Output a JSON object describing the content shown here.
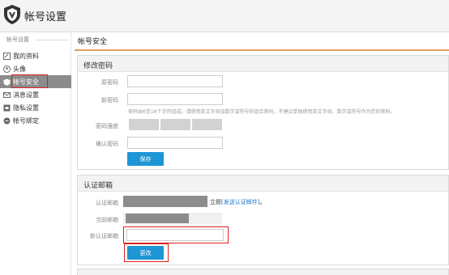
{
  "header": {
    "title": "帐号设置"
  },
  "sidebar": {
    "heading": "帐号设置",
    "items": [
      {
        "label": "我的资料",
        "icon": "edit-icon"
      },
      {
        "label": "头像",
        "icon": "avatar-icon"
      },
      {
        "label": "帐号安全",
        "icon": "shield-icon",
        "active": true
      },
      {
        "label": "消息设置",
        "icon": "message-icon"
      },
      {
        "label": "隐私设置",
        "icon": "privacy-icon"
      },
      {
        "label": "帐号绑定",
        "icon": "bind-icon"
      }
    ]
  },
  "main": {
    "title": "帐号安全",
    "password_section": {
      "title": "修改密码",
      "old_password_label": "原密码",
      "new_password_label": "新密码",
      "password_hint": "密码由6至16个字符组成，请使用英文字母加数字或符号的组合密码，不建议单独使用英文字母、数字或符号作为您的密码。",
      "strength_label": "密码强度",
      "confirm_label": "确认密码",
      "save_label": "保存"
    },
    "email_section": {
      "title": "认证邮箱",
      "verified_label": "认证邮箱",
      "verify_now": "立即",
      "send_link": "[发送认证邮件]",
      "send_suffix": "。",
      "current_label": "当前邮箱",
      "new_label": "新认证邮箱",
      "change_label": "更改"
    }
  },
  "colors": {
    "accent_blue": "#1e96d6",
    "active_sidebar": "#8c8c8c",
    "highlight_red": "#e02020",
    "title_rule": "#e0a060"
  }
}
